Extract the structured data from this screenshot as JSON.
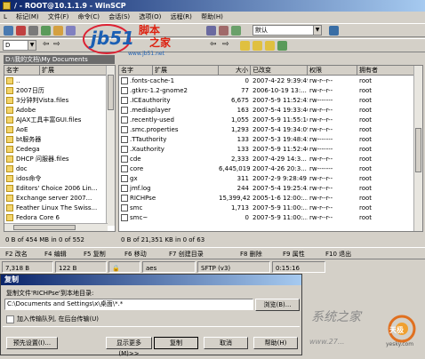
{
  "window": {
    "title": "/ - ROOT@10.1.1.9 - WinSCP"
  },
  "menu": [
    "L",
    "标记(M)",
    "文件(F)",
    "命令(C)",
    "会话(S)",
    "选项(O)",
    "远程(R)",
    "帮助(H)"
  ],
  "toolbar": {
    "session_combo": "默认",
    "drive_combo": "D"
  },
  "logo": {
    "text": "jb51",
    "cn1": "脚本",
    "cn2": "之家",
    "url": "www.jb51.net"
  },
  "left_pane": {
    "path": "D:\\我的文档\\My Documents",
    "columns": [
      "名字",
      "扩展"
    ],
    "items": [
      "..",
      "2007日历",
      "3分钟判Vista.files",
      "Adobe",
      "AJAX工具丰富GUI.files",
      "AoE",
      "bt服务器",
      "Cedega",
      "DHCP 问服器.files",
      "doc",
      "idos命令",
      "Editors' Choice 2006 Lin...",
      "Exchange server 2007...",
      "Feather Linux The Swiss...",
      "Fedora Core 6"
    ]
  },
  "right_pane": {
    "columns": [
      "名字",
      "扩展",
      "大小",
      "已改变",
      "权限",
      "拥有者"
    ],
    "rows": [
      {
        "name": ".fonts-cache-1",
        "size": "0",
        "changed": "2007-4-22 9:39:49",
        "rights": "rw-r--r--",
        "owner": "root"
      },
      {
        "name": ".gtkrc-1.2-gnome2",
        "size": "77",
        "changed": "2006-10-19 13:...",
        "rights": "rw-r--r--",
        "owner": "root"
      },
      {
        "name": ".ICEauthority",
        "size": "6,675",
        "changed": "2007-5-9 11:52:45",
        "rights": "rw-------",
        "owner": "root"
      },
      {
        "name": ".mediaplayer",
        "size": "163",
        "changed": "2007-5-4 19:33:40",
        "rights": "rw-r--r--",
        "owner": "root"
      },
      {
        "name": ".recently-used",
        "size": "1,055",
        "changed": "2007-5-9 11:55:16",
        "rights": "rw-r--r--",
        "owner": "root"
      },
      {
        "name": ".smc.properties",
        "size": "1,293",
        "changed": "2007-5-4 19:34:09",
        "rights": "rw-r--r--",
        "owner": "root"
      },
      {
        "name": ".TTauthority",
        "size": "133",
        "changed": "2007-5-3 19:48:45",
        "rights": "rw-------",
        "owner": "root"
      },
      {
        "name": ".Xauthority",
        "size": "133",
        "changed": "2007-5-9 11:52:40",
        "rights": "rw-------",
        "owner": "root"
      },
      {
        "name": "cde",
        "size": "2,333",
        "changed": "2007-4-29 14:3...",
        "rights": "rw-r--r--",
        "owner": "root"
      },
      {
        "name": "core",
        "size": "6,445,019",
        "changed": "2007-4-26 20:3...",
        "rights": "rw-------",
        "owner": "root"
      },
      {
        "name": "gx",
        "size": "311",
        "changed": "2007-2-9 9:28:49",
        "rights": "rw-r--r--",
        "owner": "root"
      },
      {
        "name": "jmf.log",
        "size": "244",
        "changed": "2007-5-4 19:25:43",
        "rights": "rw-r--r--",
        "owner": "root"
      },
      {
        "name": "RICHPse",
        "size": "15,399,424",
        "changed": "2005-1-6 12:00:...",
        "rights": "rw-r--r--",
        "owner": "root"
      },
      {
        "name": "smc",
        "size": "1,713",
        "changed": "2007-5-9 11:00:...",
        "rights": "rw-r--r--",
        "owner": "root"
      },
      {
        "name": "smc~",
        "size": "0",
        "changed": "2007-5-9 11:00:...",
        "rights": "rw-r--r--",
        "owner": "root"
      }
    ]
  },
  "status": {
    "left": "0 B of 454 MB in 0 of 552",
    "right": "0 B of 21,351 KB in 0 of 63"
  },
  "fkeys": [
    "F2 改名",
    "F4 编辑",
    "F5 复制",
    "F6 移动",
    "F7 创建目录",
    "F8 删除",
    "F9 属性",
    "F10 退出"
  ],
  "bottom": {
    "transferred": "7,318 B",
    "size": "122 B",
    "cipher": "aes",
    "protocol": "SFTP (v3)",
    "time": "0:15:16"
  },
  "dialog": {
    "title": "复制",
    "label": "复制文件'RICHPse'到本地目录:",
    "target": "C:\\Documents and Settings\\x\\桌面\\*.*",
    "browse": "浏览(B)...",
    "queue_checkbox": "加入传输队列, 在后台传输(U)",
    "buttons": [
      "预先设置(I)...",
      "显示更多(M)>>",
      "复制",
      "取消",
      "帮助(H)"
    ]
  },
  "watermark": {
    "cn": "系统之家",
    "url": "www.27...",
    "brand": "天极",
    "domain": "yesky.com"
  }
}
